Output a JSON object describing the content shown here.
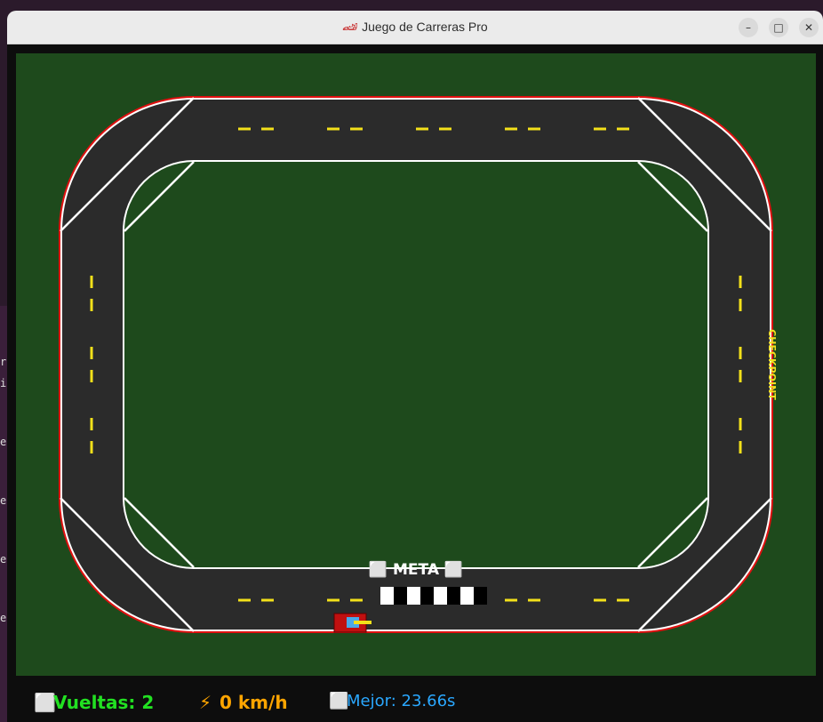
{
  "window": {
    "title": "Juego de Carreras Pro",
    "title_icon": "race-car",
    "controls": {
      "minimize": "–",
      "maximize": "□",
      "close": "✕"
    }
  },
  "track": {
    "meta_label": "⬜ META ⬜",
    "checkpoint_label": "CHECKPOINT",
    "colors": {
      "grass": "#1e4a1c",
      "asphalt": "#2b2b2b",
      "edge": "#ffffff",
      "barrier": "#e01010",
      "lane": "#f3e01a",
      "checkpoint": "#f0e020",
      "car": "#c01010"
    }
  },
  "hud": {
    "laps_icon": "⬜",
    "laps_label": "Vueltas: 2",
    "speed_icon": "⚡",
    "speed_label": "0 km/h",
    "best_icon": "⬜",
    "best_label": "Mejor: 23.66s",
    "colors": {
      "laps": "#22e022",
      "speed": "#ffa500",
      "best": "#2aa8ff"
    }
  }
}
